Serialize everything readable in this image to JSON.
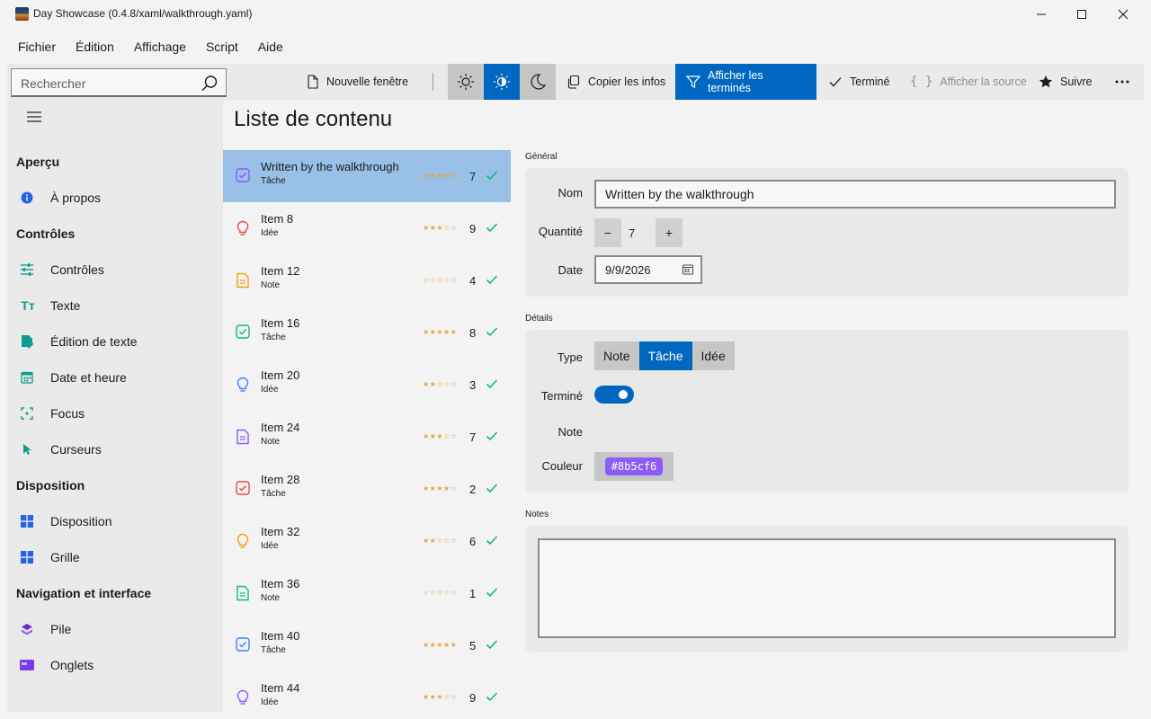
{
  "window": {
    "title": "Day Showcase (0.4.8/xaml/walkthrough.yaml)",
    "controls": [
      "minimize",
      "maximize",
      "close"
    ]
  },
  "menu": [
    "Fichier",
    "Édition",
    "Affichage",
    "Script",
    "Aide"
  ],
  "toolbar": {
    "search_placeholder": "Rechercher",
    "new_window": "Nouvelle fenêtre",
    "theme_buttons": [
      "light-theme",
      "contrast-theme",
      "dark-theme"
    ],
    "theme_active": "contrast-theme",
    "copy_info": "Copier les infos",
    "show_done": "Afficher les terminés",
    "done": "Terminé",
    "show_source": "Afficher la source",
    "follow": "Suivre",
    "more": "..."
  },
  "nav": {
    "sections": [
      {
        "header": "Aperçu",
        "items": [
          {
            "label": "À propos",
            "icon": "info-icon"
          }
        ]
      },
      {
        "header": "Contrôles",
        "items": [
          {
            "label": "Contrôles",
            "icon": "sliders-icon"
          },
          {
            "label": "Texte",
            "icon": "text-icon"
          },
          {
            "label": "Édition de texte",
            "icon": "edit-text-icon"
          },
          {
            "label": "Date et heure",
            "icon": "calendar-icon"
          },
          {
            "label": "Focus",
            "icon": "focus-icon"
          },
          {
            "label": "Curseurs",
            "icon": "cursor-icon"
          }
        ]
      },
      {
        "header": "Disposition",
        "items": [
          {
            "label": "Disposition",
            "icon": "layout-icon"
          },
          {
            "label": "Grille",
            "icon": "grid-icon"
          }
        ]
      },
      {
        "header": "Navigation et interface",
        "items": [
          {
            "label": "Pile",
            "icon": "stack-icon"
          },
          {
            "label": "Onglets",
            "icon": "tabs-icon"
          }
        ]
      }
    ]
  },
  "page_title": "Liste de contenu",
  "list": [
    {
      "title": "Written by the walkthrough",
      "type": "Tâche",
      "kind": "task",
      "color": "#8b5cf6",
      "stars": "★★★★★",
      "count": "7",
      "selected": true
    },
    {
      "title": "Item 8",
      "type": "Idée",
      "kind": "idea",
      "color": "#ef4444",
      "stars": "★★★☆☆",
      "count": "9"
    },
    {
      "title": "Item 12",
      "type": "Note",
      "kind": "note",
      "color": "#f59e0b",
      "stars": "☆☆☆☆☆",
      "count": "4"
    },
    {
      "title": "Item 16",
      "type": "Tâche",
      "kind": "task",
      "color": "#10b981",
      "stars": "★★★★★",
      "count": "8"
    },
    {
      "title": "Item 20",
      "type": "Idée",
      "kind": "idea",
      "color": "#3b82f6",
      "stars": "★★☆☆☆",
      "count": "3"
    },
    {
      "title": "Item 24",
      "type": "Note",
      "kind": "note",
      "color": "#8b5cf6",
      "stars": "★★★☆☆",
      "count": "7"
    },
    {
      "title": "Item 28",
      "type": "Tâche",
      "kind": "task",
      "color": "#ef4444",
      "stars": "★★★★☆",
      "count": "2"
    },
    {
      "title": "Item 32",
      "type": "Idée",
      "kind": "idea",
      "color": "#f59e0b",
      "stars": "★★☆☆☆",
      "count": "6"
    },
    {
      "title": "Item 36",
      "type": "Note",
      "kind": "note",
      "color": "#10b981",
      "stars": "☆☆☆☆☆",
      "count": "1"
    },
    {
      "title": "Item 40",
      "type": "Tâche",
      "kind": "task",
      "color": "#3b82f6",
      "stars": "★★★★★",
      "count": "5"
    },
    {
      "title": "Item 44",
      "type": "Idée",
      "kind": "idea",
      "color": "#8b5cf6",
      "stars": "★★★☆☆",
      "count": "9"
    }
  ],
  "details": {
    "general_label": "Général",
    "name_label": "Nom",
    "name_value": "Written by the walkthrough",
    "quantity_label": "Quantité",
    "quantity_value": "7",
    "minus": "−",
    "plus": "+",
    "date_label": "Date",
    "date_value": "9/9/2026",
    "details_label": "Détails",
    "type_label": "Type",
    "type_options": [
      "Note",
      "Tâche",
      "Idée"
    ],
    "type_selected": "Tâche",
    "done_label": "Terminé",
    "done_value": true,
    "note_label": "Note",
    "color_label": "Couleur",
    "color_value": "#8b5cf6",
    "notes_label": "Notes",
    "notes_value": ""
  },
  "colors": {
    "accent": "#0067c0",
    "selection": "#99c1e8",
    "check": "#10b981",
    "star": "#e8a33c"
  }
}
